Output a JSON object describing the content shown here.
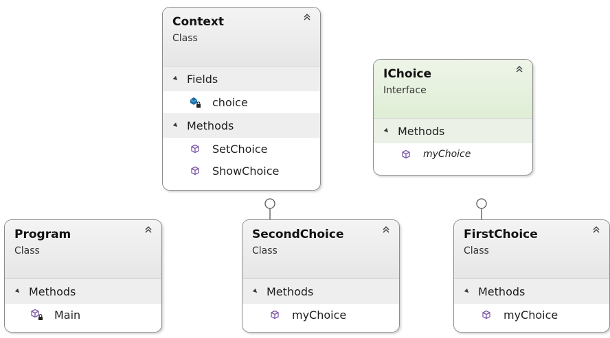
{
  "classes": {
    "context": {
      "name": "Context",
      "kind": "Class",
      "fields_label": "Fields",
      "fields": [
        "choice"
      ],
      "methods_label": "Methods",
      "methods": [
        "SetChoice",
        "ShowChoice"
      ]
    },
    "ichoice": {
      "name": "IChoice",
      "kind": "Interface",
      "methods_label": "Methods",
      "methods": [
        "myChoice"
      ]
    },
    "program": {
      "name": "Program",
      "kind": "Class",
      "methods_label": "Methods",
      "methods": [
        "Main"
      ]
    },
    "second_choice": {
      "name": "SecondChoice",
      "kind": "Class",
      "methods_label": "Methods",
      "methods": [
        "myChoice"
      ]
    },
    "first_choice": {
      "name": "FirstChoice",
      "kind": "Class",
      "methods_label": "Methods",
      "methods": [
        "myChoice"
      ]
    }
  },
  "icons": {
    "collapse": "double-chevron-up-icon",
    "field": "private-field-icon",
    "method": "method-icon",
    "private_method": "private-method-icon",
    "interface_lollipop": "interface-lollipop-icon"
  },
  "colors": {
    "method_icon": "#7e57a8",
    "field_icon": "#1b6fa8",
    "interface_header": "#e4f0dc",
    "class_header": "#ececec"
  }
}
